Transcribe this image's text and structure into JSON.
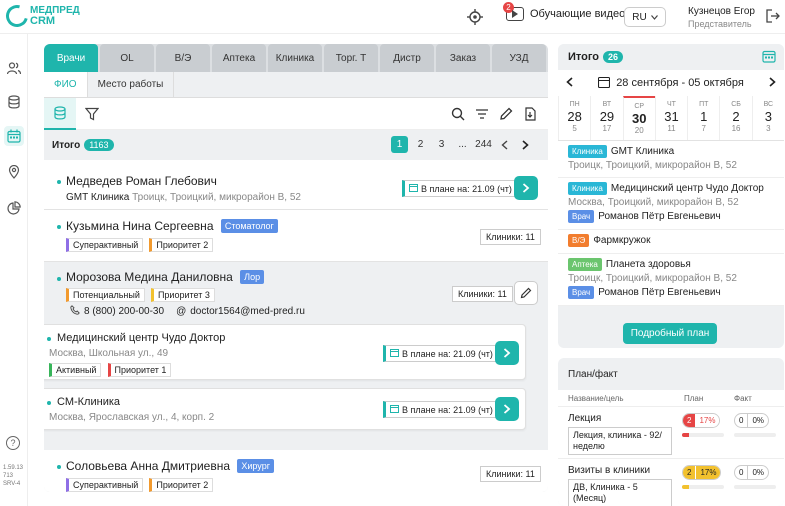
{
  "app": {
    "logo_line1": "МЕДПРЕД",
    "logo_line2": "CRM"
  },
  "header": {
    "video_label": "Обучающие видео",
    "video_badge": "2",
    "language": "RU",
    "user_name": "Кузнецов Егор",
    "user_role": "Представитель"
  },
  "version": {
    "line1": "1.59.13",
    "line2": "713",
    "line3": "SRV-4"
  },
  "tabs": [
    "Врачи",
    "OL",
    "В/Э",
    "Аптека",
    "Клиника",
    "Торг. Т",
    "Дистр",
    "Заказ",
    "УЗД"
  ],
  "subtabs": [
    "ФИО",
    "Место работы"
  ],
  "totals": {
    "label": "Итого",
    "count": "1163"
  },
  "pager": [
    "1",
    "2",
    "3",
    "...",
    "244"
  ],
  "doctors": [
    {
      "name": "Медведев Роман Глебович",
      "org": "GMT Клиника",
      "addr": "Троицк, Троицкий, микрорайон В, 52",
      "plan": "В плане на: 21.09 (чт)"
    },
    {
      "name": "Кузьмина Нина Сергеевна",
      "spec": "Стоматолог",
      "tags": [
        "Суперактивный",
        "Приоритет 2"
      ],
      "clinics": "Клиники: 11"
    },
    {
      "name": "Морозова Медина Даниловна",
      "spec": "Лор",
      "tags": [
        "Потенциальный",
        "Приоритет 3"
      ],
      "phone": "8 (800) 200-00-30",
      "email": "doctor1564@med-pred.ru",
      "clinics": "Клиники: 11"
    },
    {
      "name": "Соловьева Анна Дмитриевна",
      "spec": "Хирург",
      "tags": [
        "Суперактивный",
        "Приоритет 2"
      ],
      "clinics": "Клиники: 11"
    }
  ],
  "nested_clinics": [
    {
      "name": "Медицинский центр Чудо Доктор",
      "addr": "Москва, Школьная ул., 49",
      "tags": [
        "Активный",
        "Приоритет 1"
      ],
      "plan": "В плане на: 21.09 (чт)"
    },
    {
      "name": "СМ-Клиника",
      "addr": "Москва, Ярославская ул., 4, корп. 2",
      "plan": "В плане на: 21.09 (чт)"
    }
  ],
  "schedule": {
    "title": "Итого",
    "count": "26",
    "week": "28 сентября - 05 октября",
    "days": [
      {
        "wd": "ПН",
        "dn": "28",
        "cn": "5"
      },
      {
        "wd": "ВТ",
        "dn": "29",
        "cn": "17"
      },
      {
        "wd": "СР",
        "dn": "30",
        "cn": "20"
      },
      {
        "wd": "ЧТ",
        "dn": "31",
        "cn": "11"
      },
      {
        "wd": "ПТ",
        "dn": "1",
        "cn": "7"
      },
      {
        "wd": "СБ",
        "dn": "2",
        "cn": "16"
      },
      {
        "wd": "ВС",
        "dn": "3",
        "cn": "3"
      }
    ],
    "items": [
      {
        "tag": "Клиника",
        "name": "GMT Клиника",
        "addr": "Троицк, Троицкий, микрорайон В, 52"
      },
      {
        "tag": "Клиника",
        "name": "Медицинский центр Чудо Доктор",
        "addr": "Москва, Троицкий, микрорайон В, 52",
        "doc_tag": "Врач",
        "doc": "Романов Пётр Евгеньевич"
      },
      {
        "tag": "В/Э",
        "name": "Фармкружок"
      },
      {
        "tag": "Аптека",
        "name": "Планета здоровья",
        "addr": "Троицк, Троицкий, микрорайон В, 52",
        "doc_tag": "Врач",
        "doc": "Романов Пётр Евгеньевич"
      }
    ],
    "detail_button": "Подробный план"
  },
  "planfact": {
    "title": "План/факт",
    "col_name": "Название/цель",
    "col_plan": "План",
    "col_fact": "Факт",
    "rows": [
      {
        "name": "Лекция",
        "goal": "Лекция, клиника - 92/неделю",
        "plan": "2",
        "plan_pct": "17%",
        "fact": "0",
        "fact_pct": "0%",
        "progress": 0.17,
        "color": "#e64545"
      },
      {
        "name": "Визиты в клиники",
        "goal": "ДВ, Клиника - 5 (Месяц)",
        "plan": "2",
        "plan_pct": "17%",
        "fact": "0",
        "fact_pct": "0%",
        "progress": 0.17,
        "color": "#f2c12e"
      }
    ]
  },
  "colors": {
    "accent": "#1fb5ac",
    "red": "#e64545"
  }
}
